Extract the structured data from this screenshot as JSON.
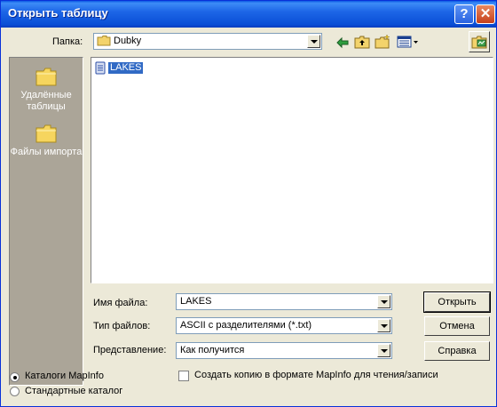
{
  "window": {
    "title": "Открыть таблицу",
    "help_glyph": "?",
    "close_glyph": "✕"
  },
  "toolbar": {
    "folder_label": "Папка:",
    "folder_value": "Dubky",
    "icons": [
      "folder-icon",
      "back-arrow-icon",
      "up-folder-icon",
      "new-folder-icon",
      "view-menu-icon",
      "mapinfo-icon"
    ]
  },
  "places": [
    {
      "label": "Удалённые таблицы"
    },
    {
      "label": "Файлы импорта"
    }
  ],
  "files": [
    {
      "name": "LAKES",
      "selected": true
    }
  ],
  "form": {
    "filename_label": "Имя файла:",
    "filename_value": "LAKES",
    "filetype_label": "Тип файлов:",
    "filetype_value": "ASCII с разделителями (*.txt)",
    "view_label": "Представление:",
    "view_value": "Как получится"
  },
  "buttons": {
    "open": "Открыть",
    "cancel": "Отмена",
    "help": "Справка"
  },
  "options": {
    "radio_mapinfo": "Каталоги MapInfo",
    "radio_standard": "Стандартные каталог",
    "radio_selected": "mapinfo",
    "copy_checkbox": "Создать копию в формате MapInfo для чтения/записи",
    "copy_checked": false
  }
}
